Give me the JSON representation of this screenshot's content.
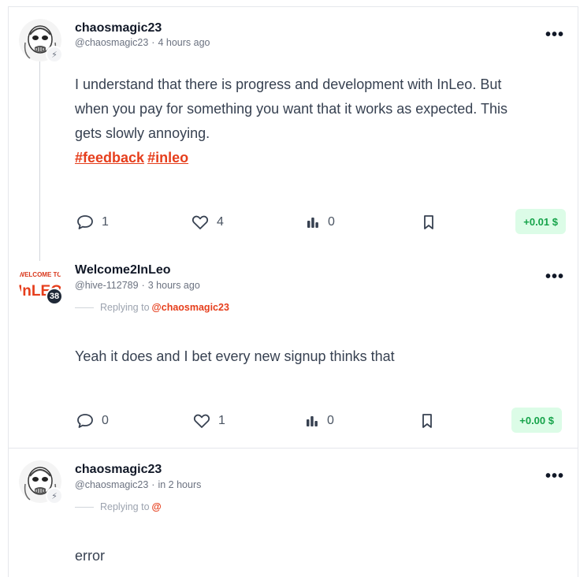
{
  "posts": [
    {
      "author": "chaosmagic23",
      "handle": "@chaosmagic23",
      "time": "4 hours ago",
      "badge": "⚡",
      "body_lines": [
        "I understand that there is progress and development with InLeo. But",
        "when you pay for something you want that it works as expected. This",
        "gets slowly annoying."
      ],
      "tags": [
        "#feedback",
        "#inleo"
      ],
      "comments": "1",
      "likes": "4",
      "views": "0",
      "earnings": "+0.01 $"
    },
    {
      "author": "Welcome2InLeo",
      "handle": "@hive-112789",
      "time": "3 hours ago",
      "badge": "38",
      "avatar_text_top": "WELCOME TO",
      "avatar_text_bottom": "InLEO",
      "reply_label": "Replying to",
      "reply_mention": "@chaosmagic23",
      "body": "Yeah it does and I bet every new signup thinks that",
      "comments": "0",
      "likes": "1",
      "views": "0",
      "earnings": "+0.00 $"
    },
    {
      "author": "chaosmagic23",
      "handle": "@chaosmagic23",
      "time": "in 2 hours",
      "badge": "⚡",
      "reply_label": "Replying to",
      "reply_mention": "@",
      "body": "error"
    }
  ],
  "separator": "·",
  "more_glyph": "•••",
  "colors": {
    "accent": "#e63e1c",
    "earn_bg": "#dcfce7",
    "earn_fg": "#16a34a"
  },
  "icons": [
    "comment-icon",
    "heart-icon",
    "views-icon",
    "bookmark-icon",
    "more-icon",
    "lightning-icon"
  ]
}
